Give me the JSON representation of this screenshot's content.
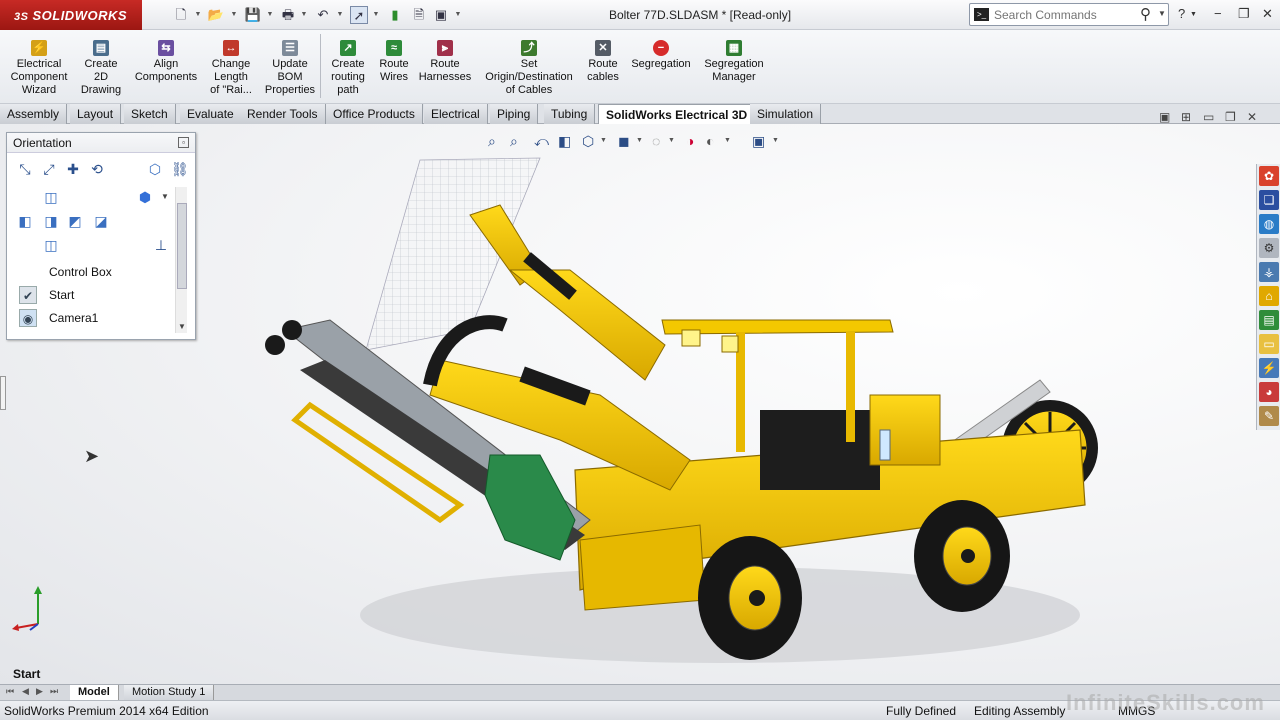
{
  "app": {
    "brand": "SOLIDWORKS",
    "brand_prefix": "3S",
    "accent": "#b3201b"
  },
  "titlebar": {
    "doc_title": "Bolter 77D.SLDASM * [Read-only]",
    "quick_access": [
      "new-icon",
      "open-icon",
      "save-icon",
      "print-icon",
      "undo-icon",
      "select-icon",
      "rebuild-icon",
      "file-properties-icon",
      "options-icon"
    ]
  },
  "search": {
    "placeholder": "Search Commands"
  },
  "ribbon": {
    "buttons": [
      {
        "label": "Electrical\nComponent\nWizard",
        "icon": "electrical-component-wizard-icon",
        "color": "#d4a017"
      },
      {
        "label": "Create\n2D\nDrawing",
        "icon": "create-2d-drawing-icon",
        "color": "#4a6d8c"
      },
      {
        "label": "Align\nComponents",
        "icon": "align-components-icon",
        "color": "#6a4fa0"
      },
      {
        "label": "Change\nLength\nof \"Rai...",
        "icon": "change-length-icon",
        "color": "#c0392b"
      },
      {
        "label": "Update\nBOM\nProperties",
        "icon": "update-bom-icon",
        "color": "#7d8a99"
      },
      {
        "label": "Create\nrouting\npath",
        "icon": "create-routing-path-icon",
        "color": "#2e8b3a"
      },
      {
        "label": "Route\nWires",
        "icon": "route-wires-icon",
        "color": "#2e8b3a"
      },
      {
        "label": "Route\nHarnesses",
        "icon": "route-harnesses-icon",
        "color": "#a0304a"
      },
      {
        "label": "Set\nOrigin/Destination\nof Cables",
        "icon": "set-origin-destination-icon",
        "color": "#3d7a2e"
      },
      {
        "label": "Route\ncables",
        "icon": "route-cables-icon",
        "color": "#555c66"
      },
      {
        "label": "Segregation",
        "icon": "segregation-icon",
        "color": "#d62b2b"
      },
      {
        "label": "Segregation\nManager",
        "icon": "segregation-manager-icon",
        "color": "#2f7d32"
      }
    ]
  },
  "tabs": [
    "Assembly",
    "Layout",
    "Sketch",
    "Evaluate",
    "Render Tools",
    "Office Products",
    "Electrical",
    "Piping",
    "Tubing",
    "SolidWorks Electrical 3D",
    "Simulation"
  ],
  "active_tab": "SolidWorks Electrical 3D",
  "orientation": {
    "title": "Orientation",
    "items": [
      {
        "label": "Control Box",
        "icon": "view-icon"
      },
      {
        "label": "Start",
        "icon": "checked-view-icon"
      },
      {
        "label": "Camera1",
        "icon": "camera-icon"
      }
    ]
  },
  "viewport": {
    "view_name": "Start",
    "model": "Bolter 77D",
    "body_color": "#f2c500",
    "shadow_color": "#cfcfcf"
  },
  "bottom_tabs": {
    "model": "Model",
    "motion": "Motion Study 1"
  },
  "status": {
    "edition": "SolidWorks Premium 2014 x64 Edition",
    "defined": "Fully Defined",
    "mode": "Editing Assembly",
    "units": "MMGS",
    "watermark": "InfiniteSkills.com"
  }
}
